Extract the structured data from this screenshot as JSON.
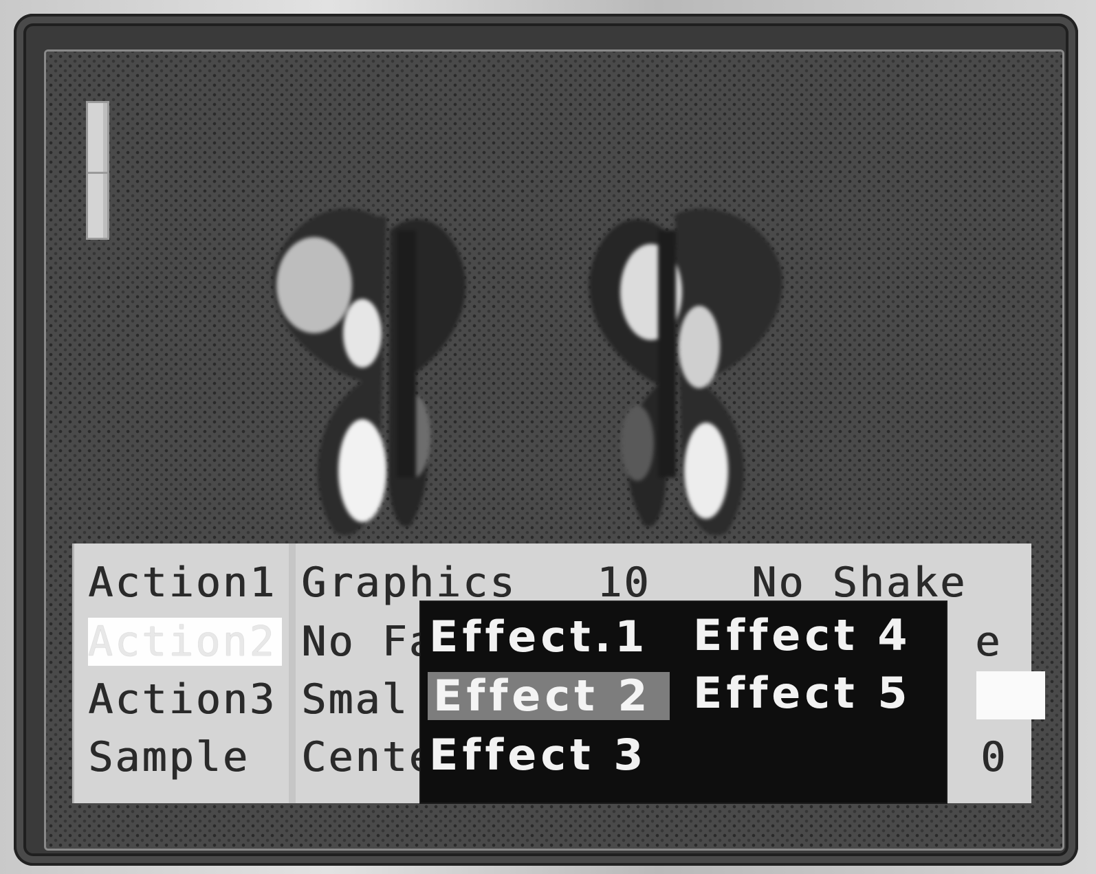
{
  "menu": {
    "actions": [
      "Action1",
      "Action2",
      "Action3",
      "Sample"
    ],
    "selected_action_index": 1,
    "row1": {
      "graphics_label": "Graphics",
      "graphics_value": "10",
      "shake_label": "No Shake"
    },
    "row2_fragment": "No Fa",
    "row2_right_fragment": "e",
    "row3_fragment": "Smal",
    "row4_fragment": "Cente",
    "row4_right_fragment": "0"
  },
  "effects_popup": {
    "items": [
      "Effect.1",
      "Effect 2",
      "Effect 3",
      "Effect 4",
      "Effect 5"
    ],
    "highlighted": "Effect 2"
  },
  "colors": {
    "menu_bg": "#d5d5d5",
    "popup_bg": "#0e0e0e",
    "highlight": "#7d7d7d",
    "frame": "#3a3a3a"
  }
}
